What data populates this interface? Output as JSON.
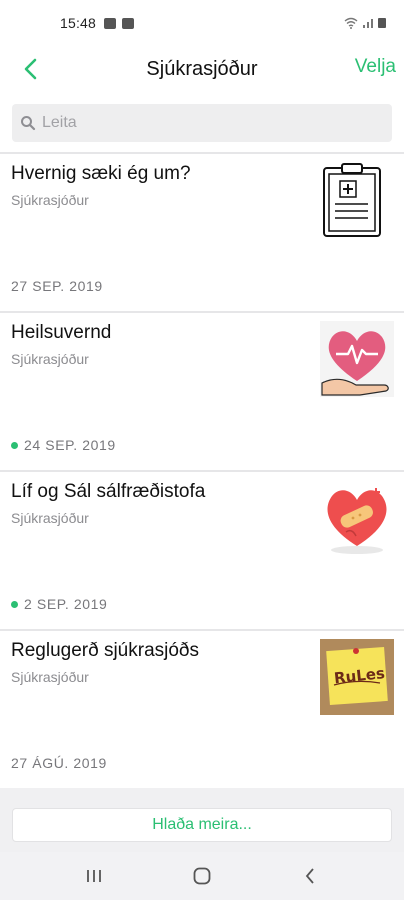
{
  "status_bar": {
    "time": "15:48"
  },
  "header": {
    "title": "Sjúkrasjóður",
    "action_label": "Velja"
  },
  "search": {
    "placeholder": "Leita"
  },
  "items": [
    {
      "title": "Hvernig sæki ég um?",
      "subtitle": "Sjúkrasjóður",
      "date": "27 SEP. 2019",
      "unread": false,
      "thumb": "clipboard-icon"
    },
    {
      "title": "Heilsuvernd",
      "subtitle": "Sjúkrasjóður",
      "date": "24 SEP. 2019",
      "unread": true,
      "thumb": "heart-hand-icon"
    },
    {
      "title": "Líf og Sál sálfræðistofa",
      "subtitle": "Sjúkrasjóður",
      "date": "2 SEP. 2019",
      "unread": true,
      "thumb": "bandaged-heart-icon"
    },
    {
      "title": "Reglugerð sjúkrasjóðs",
      "subtitle": "Sjúkrasjóður",
      "date": "27 ÁGÚ. 2019",
      "unread": false,
      "thumb": "rules-note-icon"
    }
  ],
  "footer": {
    "load_more_label": "Hlaða meira..."
  },
  "colors": {
    "accent": "#2bbf73",
    "divider": "#e6e6e8"
  }
}
